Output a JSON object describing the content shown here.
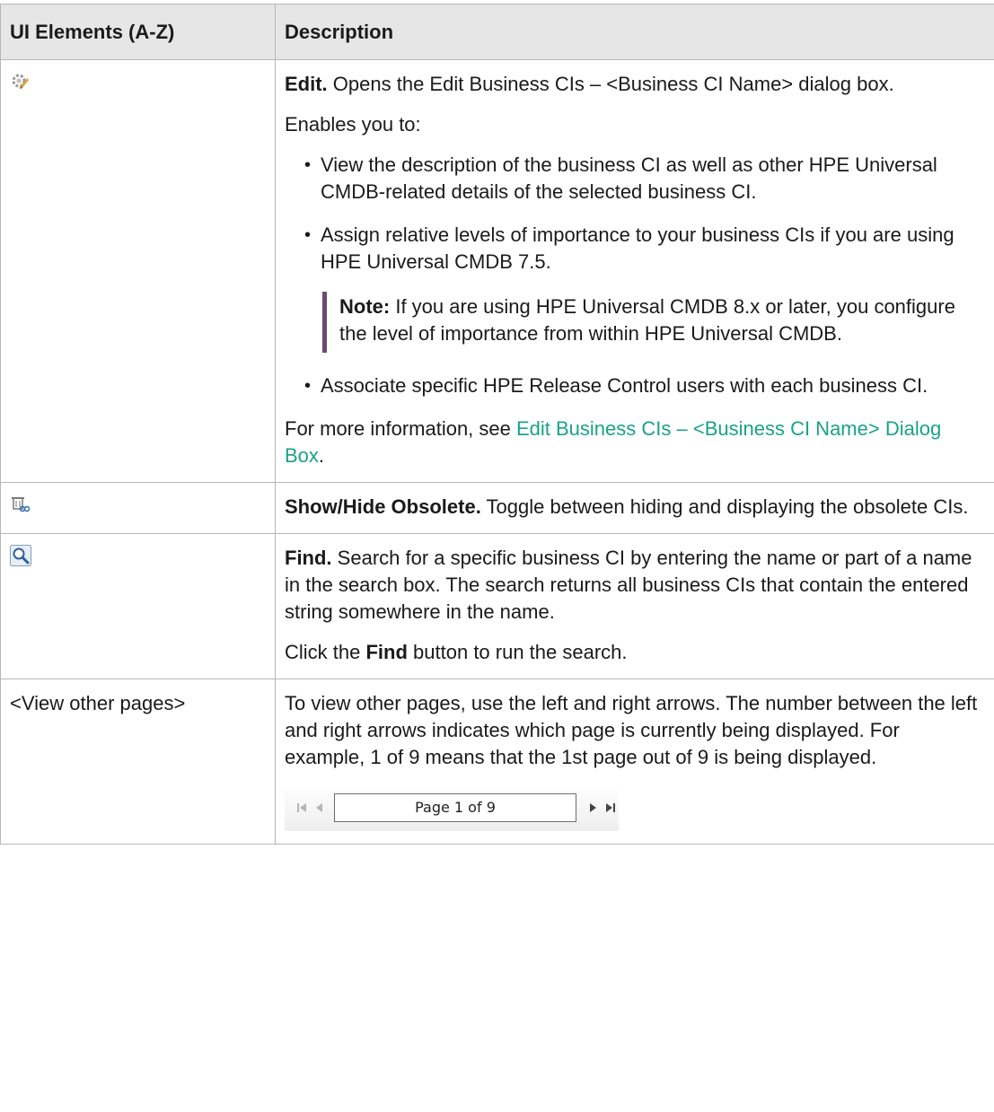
{
  "table": {
    "headers": [
      "UI Elements (A-Z)",
      "Description"
    ],
    "edit": {
      "icon": "edit-gear-pencil-icon",
      "title": "Edit.",
      "desc": "Opens the Edit Business CIs – <Business CI Name> dialog box.",
      "enables": "Enables you to:",
      "bullets": [
        "View the description of the business CI as well as other HPE Universal CMDB-related details of the selected business CI.",
        "Assign relative levels of importance to your business CIs if you are using HPE Universal CMDB 7.5.",
        "Associate specific HPE Release Control users with each business CI."
      ],
      "note_label": "Note:",
      "note_text": "If you are using HPE Universal CMDB 8.x or later, you configure the level of importance from within HPE Universal CMDB.",
      "more_prefix": "For more information, see ",
      "more_link": "Edit Business CIs – <Business CI Name> Dialog Box",
      "more_suffix": "."
    },
    "show_hide": {
      "icon": "show-hide-obsolete-icon",
      "title": "Show/Hide Obsolete.",
      "desc": "Toggle between hiding and displaying the obsolete CIs."
    },
    "find": {
      "icon": "magnifier-search-icon",
      "title": "Find.",
      "desc": "Search for a specific business CI by entering the name or part of a name in the search box. The search returns all business CIs that contain the entered string somewhere in the name.",
      "click_prefix": "Click the ",
      "click_bold": "Find",
      "click_suffix": " button to run the search."
    },
    "pages": {
      "element": "<View other pages>",
      "desc": "To view other pages, use the left and right arrows. The number between the left and right arrows indicates which page is currently being displayed. For example, 1 of 9 means that the 1st page out of 9 is being displayed.",
      "pager_text": "Page 1 of 9"
    }
  },
  "colors": {
    "header_bg": "#e6e6e6",
    "link": "#1aa288",
    "note_bar": "#6b4a6f",
    "border": "#b7b7b7"
  }
}
